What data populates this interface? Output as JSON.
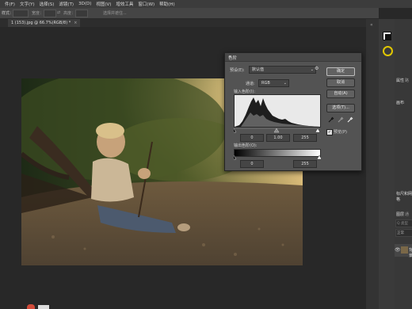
{
  "menu": [
    "件(F)",
    "文字(Y)",
    "选择(S)",
    "滤镜(T)",
    "3D(D)",
    "视图(V)",
    "增效工具",
    "窗口(W)",
    "帮助(H)"
  ],
  "options_bar": {
    "tool_label": "样式：",
    "label_width": "宽度：",
    "label_height": "高度：",
    "mask_button": "选择并遮住..."
  },
  "document_tab": {
    "title": "1 (153).jpg @ 66.7%(RGB/8) *",
    "close": "×"
  },
  "levels_dialog": {
    "title": "色阶",
    "preset_label": "预设(E):",
    "preset_value": "默认值",
    "channel_label": "通道:",
    "channel_value": "RGB",
    "input_levels_label": "输入色阶(I):",
    "output_levels_label": "输出色阶(O):",
    "input_black": "0",
    "input_gamma": "1.00",
    "input_white": "255",
    "output_black": "0",
    "output_white": "255",
    "buttons": {
      "ok": "确定",
      "cancel": "取消",
      "auto": "自动(A)",
      "options": "选项(T)..."
    },
    "preview_label": "预览(P)",
    "preview_checked": true
  },
  "right_panel": {
    "tab_properties": "属性",
    "tab_paths": "路",
    "section_image": "画布",
    "section_rulers": "标尺和网格",
    "tab_layers": "图层",
    "tab_channels": "通",
    "search_placeholder": "Q 类型",
    "blend_mode": "正常",
    "layer_name": "背景"
  },
  "colors": {
    "accent_ring": "#e0c600",
    "dialog_bg": "#535353"
  }
}
